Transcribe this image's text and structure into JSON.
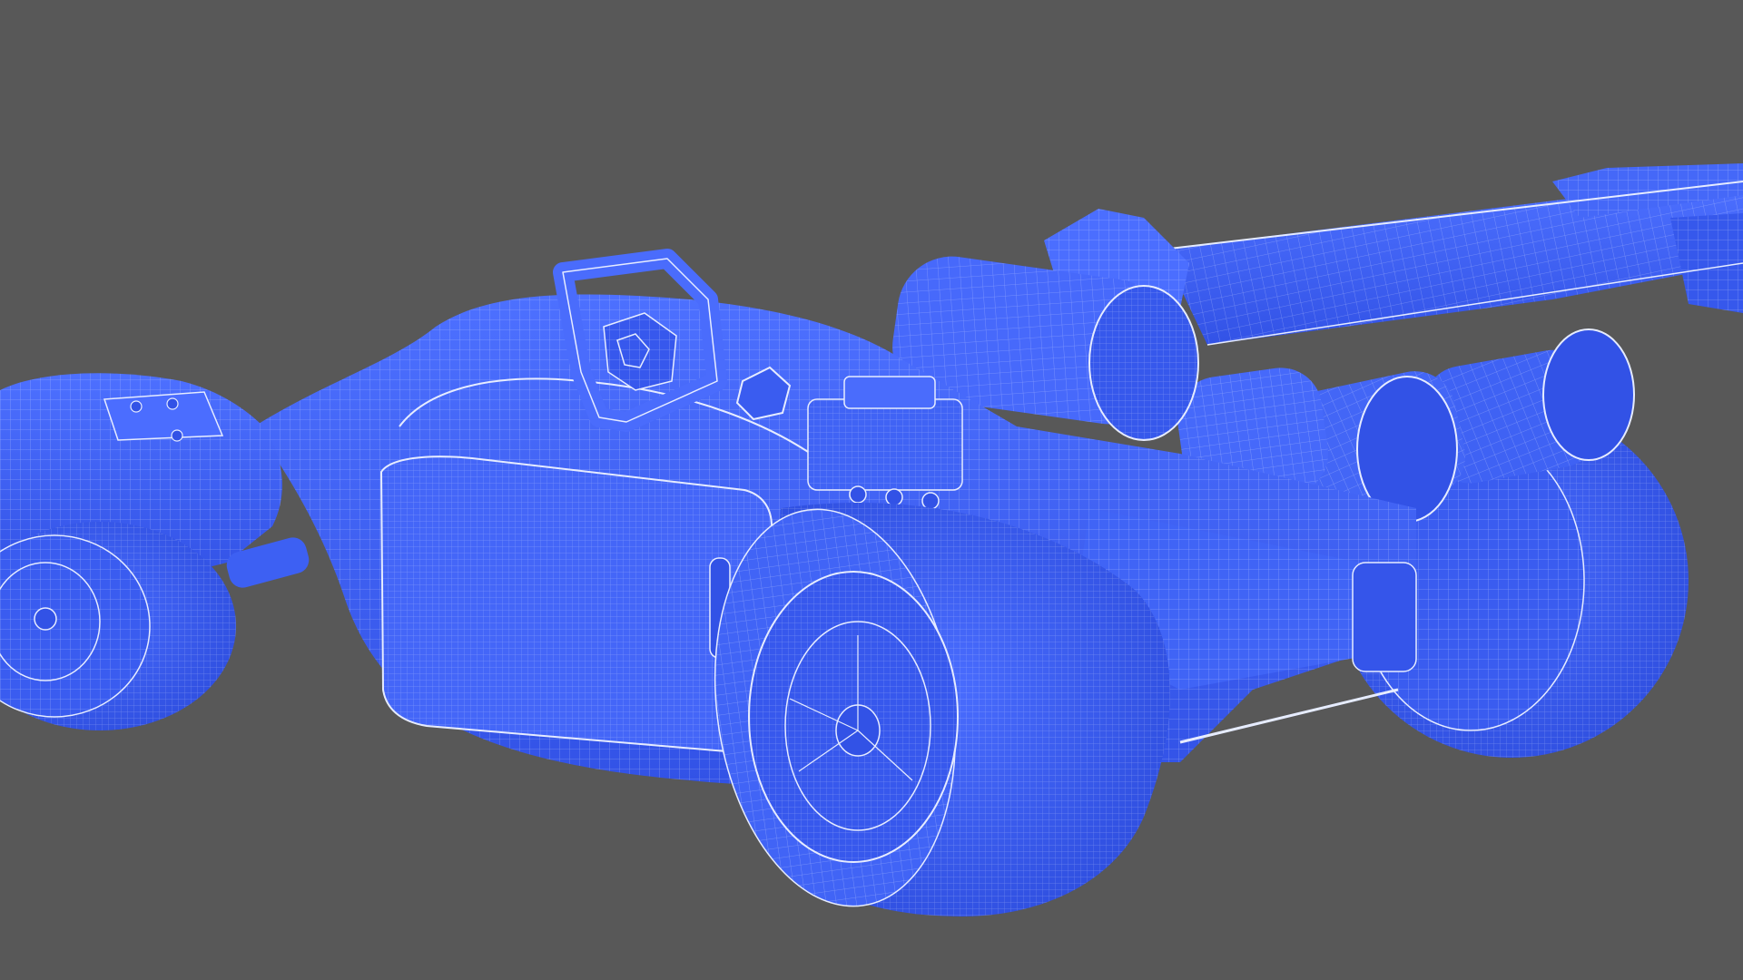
{
  "viewport": {
    "background_color": "#585858",
    "model_color": "#3e63f2",
    "model_shadow_color": "#2740c8",
    "model_highlight_color": "#5b7bff",
    "wire_color": "#e6ecff"
  }
}
